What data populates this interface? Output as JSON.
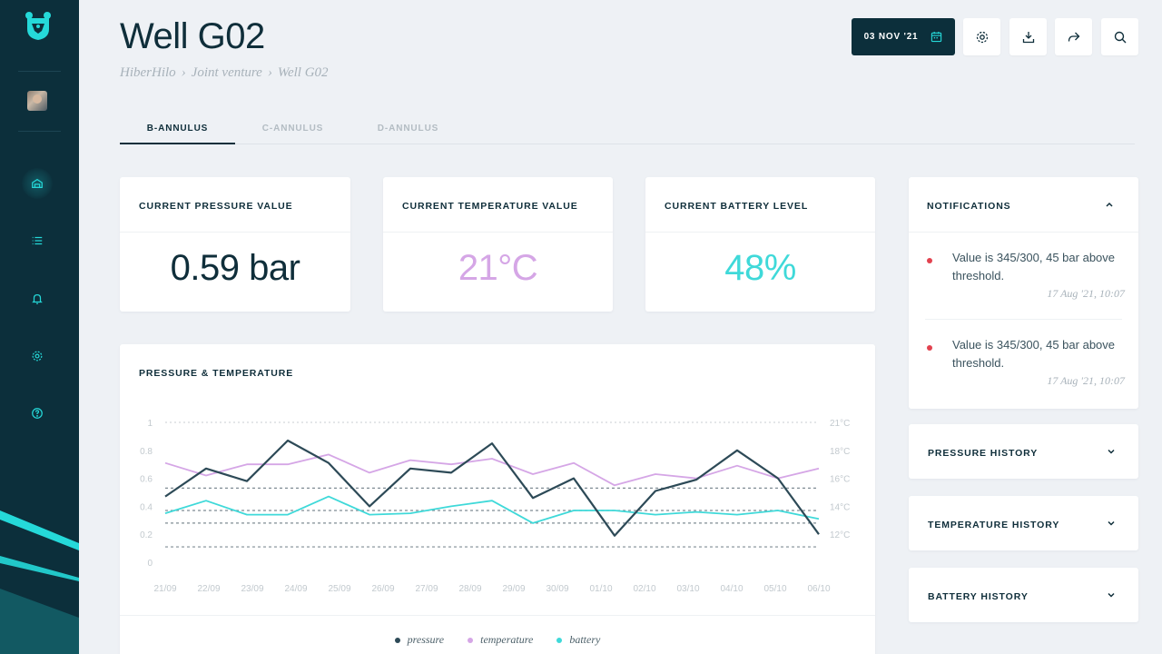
{
  "page": {
    "title": "Well G02",
    "breadcrumb": [
      "HiberHilo",
      "Joint venture",
      "Well G02"
    ]
  },
  "header": {
    "date": "03 NOV '21",
    "buttons": [
      "gear-icon",
      "download-icon",
      "share-icon",
      "search-icon"
    ]
  },
  "tabs": [
    {
      "label": "B-ANNULUS",
      "active": true
    },
    {
      "label": "C-ANNULUS",
      "active": false
    },
    {
      "label": "D-ANNULUS",
      "active": false
    }
  ],
  "metrics": {
    "pressure": {
      "label": "CURRENT PRESSURE VALUE",
      "value": "0.59 bar",
      "color": "#0f2e3a"
    },
    "temperature": {
      "label": "CURRENT TEMPERATURE VALUE",
      "value": "21°C",
      "color": "#d5a6e6"
    },
    "battery": {
      "label": "CURRENT BATTERY LEVEL",
      "value": "48%",
      "color": "#3fd9d9"
    }
  },
  "notifications": {
    "title": "NOTIFICATIONS",
    "items": [
      {
        "text": "Value is 345/300, 45 bar above threshold.",
        "time": "17 Aug '21, 10:07"
      },
      {
        "text": "Value is 345/300, 45 bar above threshold.",
        "time": "17 Aug '21, 10:07"
      }
    ]
  },
  "accordions": [
    {
      "label": "PRESSURE HISTORY"
    },
    {
      "label": "TEMPERATURE HISTORY"
    },
    {
      "label": "BATTERY HISTORY"
    }
  ],
  "chart": {
    "title": "PRESSURE & TEMPERATURE",
    "legend": [
      "pressure",
      "temperature",
      "battery"
    ]
  },
  "colors": {
    "pressure": "#2d4a57",
    "temperature": "#d5a6e6",
    "battery": "#3fd9d9",
    "alert": "#e2424f",
    "sidebar": "#0c2f3b",
    "accent": "#25d9d9"
  },
  "chart_data": {
    "type": "line",
    "title": "PRESSURE & TEMPERATURE",
    "x": [
      "21/09",
      "22/09",
      "23/09",
      "24/09",
      "25/09",
      "26/09",
      "27/09",
      "28/09",
      "29/09",
      "30/09",
      "01/10",
      "02/10",
      "03/10",
      "04/10",
      "05/10",
      "06/10"
    ],
    "y_left_ticks": [
      "0",
      "0.2",
      "0.4",
      "0.6",
      "0.8",
      "1"
    ],
    "y_right_ticks": [
      "12°C",
      "14°C",
      "16°C",
      "18°C",
      "21°C"
    ],
    "ylim": [
      0,
      1
    ],
    "series": [
      {
        "name": "pressure",
        "values": [
          0.47,
          0.67,
          0.58,
          0.87,
          0.71,
          0.4,
          0.67,
          0.64,
          0.85,
          0.46,
          0.6,
          0.19,
          0.51,
          0.59,
          0.8,
          0.6,
          0.2
        ]
      },
      {
        "name": "temperature",
        "values": [
          0.71,
          0.62,
          0.7,
          0.7,
          0.77,
          0.64,
          0.73,
          0.7,
          0.74,
          0.63,
          0.71,
          0.55,
          0.63,
          0.6,
          0.69,
          0.6,
          0.67
        ]
      },
      {
        "name": "battery",
        "values": [
          0.35,
          0.44,
          0.34,
          0.34,
          0.47,
          0.34,
          0.35,
          0.4,
          0.44,
          0.28,
          0.37,
          0.37,
          0.34,
          0.36,
          0.34,
          0.37,
          0.31
        ]
      }
    ],
    "threshold_lines": [
      0.53,
      0.37,
      0.28,
      0.11
    ],
    "grid": true,
    "legend_position": "bottom-center"
  }
}
